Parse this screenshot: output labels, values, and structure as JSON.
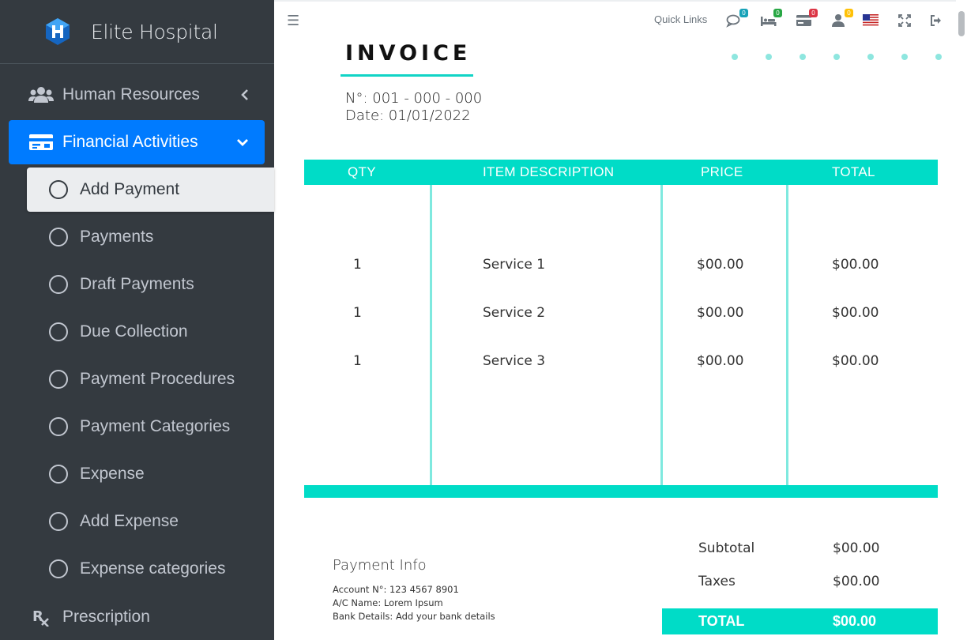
{
  "brand": {
    "name": "Elite Hospital"
  },
  "sidebar": {
    "human_resources": "Human Resources",
    "financial_activities": "Financial Activities",
    "prescription": "Prescription",
    "sub_items": [
      "Add Payment",
      "Payments",
      "Draft Payments",
      "Due Collection",
      "Payment Procedures",
      "Payment Categories",
      "Expense",
      "Add Expense",
      "Expense categories"
    ]
  },
  "topbar": {
    "quick_links": "Quick Links",
    "badges": {
      "chat": "0",
      "bed": "0",
      "payment": "0",
      "user": "0"
    },
    "colors": {
      "chat": "#17a2b8",
      "bed": "#28a745",
      "payment": "#dc3545",
      "user": "#ffc107"
    }
  },
  "invoice": {
    "title": "INVOICE",
    "number": "N°: 001 - 000 - 000",
    "date": "Date: 01/01/2022",
    "headers": {
      "qty": "QTY",
      "description": "ITEM DESCRIPTION",
      "price": "PRICE",
      "total": "TOTAL"
    },
    "rows": [
      {
        "qty": "1",
        "description": "Service 1",
        "price": "$00.00",
        "total": "$00.00"
      },
      {
        "qty": "1",
        "description": "Service 2",
        "price": "$00.00",
        "total": "$00.00"
      },
      {
        "qty": "1",
        "description": "Service 3",
        "price": "$00.00",
        "total": "$00.00"
      }
    ],
    "payment_info": {
      "title": "Payment Info",
      "account": "Account N°: 123 4567 8901",
      "ac_name": "A/C Name: Lorem Ipsum",
      "bank": "Bank Details: Add your bank details"
    },
    "summary": {
      "subtotal_label": "Subtotal",
      "subtotal_value": "$00.00",
      "taxes_label": "Taxes",
      "taxes_value": "$00.00",
      "total_label": "TOTAL",
      "total_value": "$00.00"
    }
  },
  "colors": {
    "accent": "#00dcc7",
    "sidebar_bg": "#343a40",
    "active_blue": "#007bff"
  }
}
